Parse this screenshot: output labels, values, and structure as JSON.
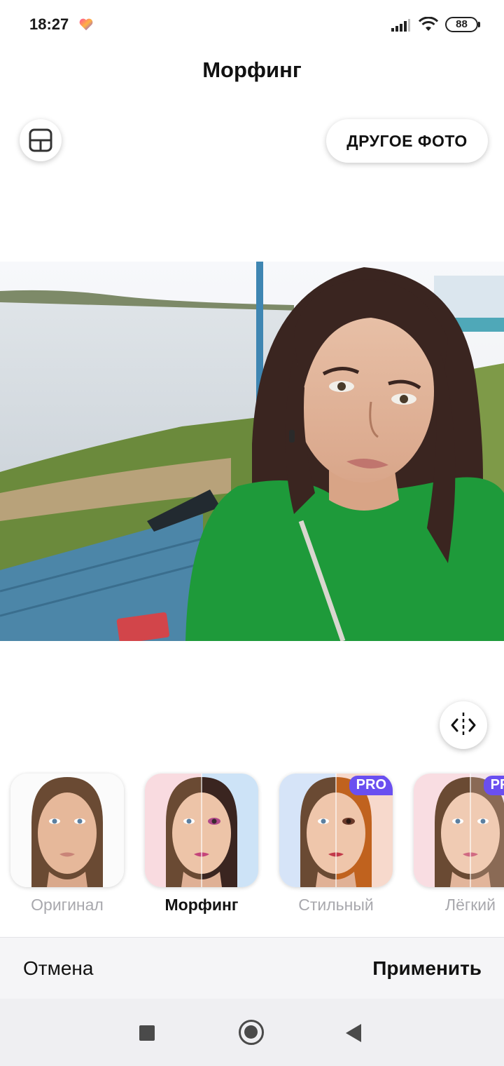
{
  "status_bar": {
    "time": "18:27",
    "battery": "88",
    "icons": [
      "heart-app-icon",
      "signal-icon",
      "wifi-icon",
      "battery-icon"
    ]
  },
  "header": {
    "title": "Морфинг",
    "layout_icon": "layout-icon",
    "other_photo_label": "ДРУГОЕ ФОТО"
  },
  "photo": {
    "compare_icon": "compare-split-icon"
  },
  "filters": {
    "items": [
      {
        "label": "Оригинал",
        "pro": false,
        "active": false
      },
      {
        "label": "Морфинг",
        "pro": false,
        "active": true
      },
      {
        "label": "Стильный",
        "pro": true,
        "active": false
      },
      {
        "label": "Лёгкий",
        "pro": true,
        "active": false
      }
    ],
    "pro_label": "PRO"
  },
  "actions": {
    "cancel_label": "Отмена",
    "apply_label": "Применить"
  },
  "nav": {
    "icons": [
      "recents-icon",
      "home-icon",
      "back-icon"
    ]
  },
  "colors": {
    "accent": "#6a4ff0",
    "inactive_label": "#a8a8ad",
    "shirt": "#1e9a3a"
  }
}
